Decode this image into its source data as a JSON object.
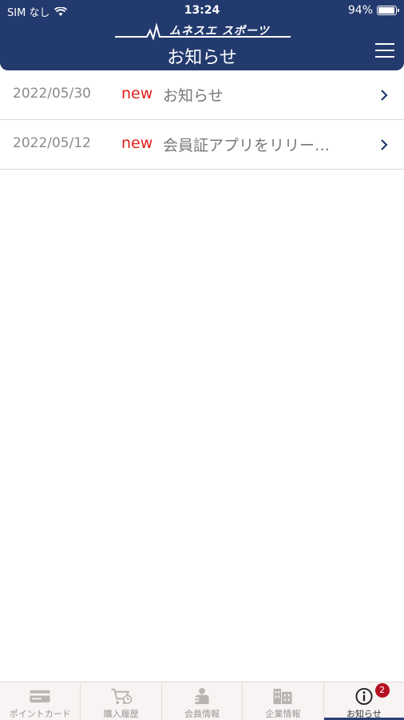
{
  "status_bar": {
    "carrier": "SIM なし",
    "time": "13:24",
    "battery": "94%",
    "battery_level": 0.94
  },
  "header": {
    "logo_text": "ムネスエ スポーツ",
    "title": "お知らせ"
  },
  "notices": [
    {
      "date": "2022/05/30",
      "new_label": "new",
      "title": "お知らせ"
    },
    {
      "date": "2022/05/12",
      "new_label": "new",
      "title": "会員証アプリをリリー…"
    }
  ],
  "tabs": [
    {
      "label": "ポイントカード",
      "icon": "card-icon"
    },
    {
      "label": "購入履歴",
      "icon": "cart-icon"
    },
    {
      "label": "会員情報",
      "icon": "member-icon"
    },
    {
      "label": "企業情報",
      "icon": "building-icon"
    },
    {
      "label": "お知らせ",
      "icon": "info-icon",
      "badge": "2",
      "active": true
    }
  ],
  "colors": {
    "header": "#233a6e",
    "new": "#e2201a",
    "badge": "#b5101f"
  }
}
